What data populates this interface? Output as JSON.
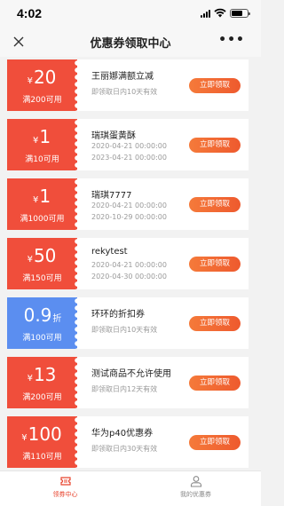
{
  "status_bar": {
    "time": "4:02"
  },
  "nav": {
    "title": "优惠券领取中心",
    "more": "•••"
  },
  "colors": {
    "coupon_red": "#f04e3b",
    "coupon_blue": "#5b8ef0",
    "button_orange": "#ee5a2e",
    "tab_active": "#e8452f"
  },
  "coupons": [
    {
      "currency": "¥",
      "amount": "20",
      "unit": "",
      "limit": "满200可用",
      "title": "王丽娜满额立减",
      "validity": "即领取日内10天有效",
      "button": "立即领取"
    },
    {
      "currency": "¥",
      "amount": "1",
      "unit": "",
      "limit": "满10可用",
      "title": "瑞琪蛋黄酥",
      "start": "2020-04-21 00:00:00",
      "end": "2023-04-21 00:00:00",
      "button": "立即领取"
    },
    {
      "currency": "¥",
      "amount": "1",
      "unit": "",
      "limit": "满1000可用",
      "title": "瑞琪7777",
      "start": "2020-04-21 00:00:00",
      "end": "2020-10-29 00:00:00",
      "button": "立即领取"
    },
    {
      "currency": "¥",
      "amount": "50",
      "unit": "",
      "limit": "满150可用",
      "title": "rekytest",
      "start": "2020-04-21 00:00:00",
      "end": "2020-04-30 00:00:00",
      "button": "立即领取"
    },
    {
      "currency": "",
      "amount": "0.9",
      "unit": "折",
      "limit": "满100可用",
      "title": "环环的折扣券",
      "validity": "即领取日内10天有效",
      "button": "立即领取"
    },
    {
      "currency": "¥",
      "amount": "13",
      "unit": "",
      "limit": "满200可用",
      "title": "测试商品不允许使用",
      "validity": "即领取日内12天有效",
      "button": "立即领取"
    },
    {
      "currency": "¥",
      "amount": "100",
      "unit": "",
      "limit": "满110可用",
      "title": "华为p40优惠券",
      "validity": "即领取日内30天有效",
      "button": "立即领取"
    }
  ],
  "tabs": [
    {
      "label": "领券中心",
      "icon": "coupon-ticket-icon",
      "active": true
    },
    {
      "label": "我的优惠券",
      "icon": "user-icon",
      "active": false
    }
  ]
}
